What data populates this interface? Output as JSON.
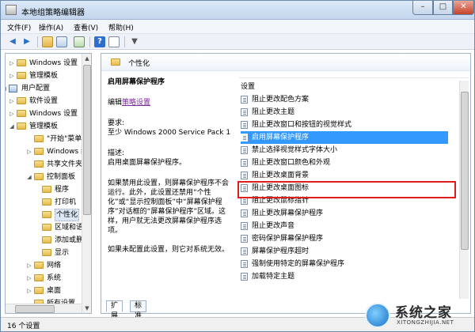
{
  "window": {
    "title": "本地组策略编辑器",
    "controls": {
      "minimize": "–",
      "maximize": "□",
      "close": "✕"
    }
  },
  "menubar": {
    "items": [
      "文件(F)",
      "操作(A)",
      "查看(V)",
      "帮助(H)"
    ]
  },
  "toolbar": {
    "icons": [
      "back-icon",
      "forward-icon",
      "up-folder-icon",
      "show-hide-tree-icon",
      "export-list-icon",
      "help-icon",
      "properties-icon",
      "filter-icon"
    ]
  },
  "tree": {
    "items": [
      {
        "label": "Windows 设置",
        "toggle": "▷",
        "icon": "folder"
      },
      {
        "label": "管理模板",
        "toggle": "▷",
        "icon": "folder"
      },
      {
        "label": "用户配置",
        "toggle": "◢",
        "icon": "user-config"
      },
      {
        "label": "软件设置",
        "toggle": "▷",
        "icon": "folder"
      },
      {
        "label": "Windows 设置",
        "toggle": "▷",
        "icon": "folder"
      },
      {
        "label": "管理模板",
        "toggle": "◢",
        "icon": "folder"
      },
      {
        "label": "\"开始\"菜单和",
        "toggle": "",
        "icon": "folder"
      },
      {
        "label": "Windows 组件",
        "toggle": "▷",
        "icon": "folder"
      },
      {
        "label": "共享文件夹",
        "toggle": "",
        "icon": "folder"
      },
      {
        "label": "控制面板",
        "toggle": "◢",
        "icon": "folder"
      },
      {
        "label": "程序",
        "toggle": "",
        "icon": "folder"
      },
      {
        "label": "打印机",
        "toggle": "",
        "icon": "folder"
      },
      {
        "label": "个性化",
        "toggle": "",
        "icon": "folder",
        "selected": true
      },
      {
        "label": "区域和语言",
        "toggle": "",
        "icon": "folder"
      },
      {
        "label": "添加或删除",
        "toggle": "",
        "icon": "folder"
      },
      {
        "label": "显示",
        "toggle": "",
        "icon": "folder"
      },
      {
        "label": "网络",
        "toggle": "▷",
        "icon": "folder"
      },
      {
        "label": "系统",
        "toggle": "▷",
        "icon": "folder"
      },
      {
        "label": "桌面",
        "toggle": "▷",
        "icon": "folder"
      },
      {
        "label": "所有设置",
        "toggle": "",
        "icon": "folder"
      }
    ]
  },
  "right": {
    "header": "个性化",
    "description": {
      "title": "启用屏幕保护程序",
      "edit_prefix": "编辑",
      "edit_link": "策略设置",
      "requirements_label": "要求:",
      "requirements_value": "至少 Windows 2000 Service Pack 1",
      "desc_label": "描述:",
      "desc_value": "启用桌面屏幕保护程序。",
      "para1": "如果禁用此设置，则屏幕保护程序不会运行。此外，此设置还禁用“个性化”或“显示控制面板”中“屏幕保护程序”对话框的“屏幕保护程序”区域。这样，用户就无法更改屏幕保护程序选项。",
      "para2": "如果未配置此设置，则它对系统无效。"
    },
    "settings_header": "设置",
    "settings": [
      "阻止更改配色方案",
      "阻止更改主题",
      "阻止更改窗口和按钮的视觉样式",
      "启用屏幕保护程序",
      "禁止选择视觉样式字体大小",
      "阻止更改窗口颜色和外观",
      "阻止更改桌面背景",
      "阻止更改桌面图标",
      "阻止更改鼠标指针",
      "阻止更改屏幕保护程序",
      "阻止更改声音",
      "密码保护屏幕保护程序",
      "屏幕保护程序超时",
      "强制使用特定的屏幕保护程序",
      "加载特定主题"
    ],
    "selected_setting": "启用屏幕保护程序",
    "tabs": [
      "扩展",
      "标准"
    ]
  },
  "statusbar": {
    "text": "16 个设置"
  },
  "watermark": {
    "main": "系统之家",
    "sub": "XITONGZHIJIA.NET"
  }
}
